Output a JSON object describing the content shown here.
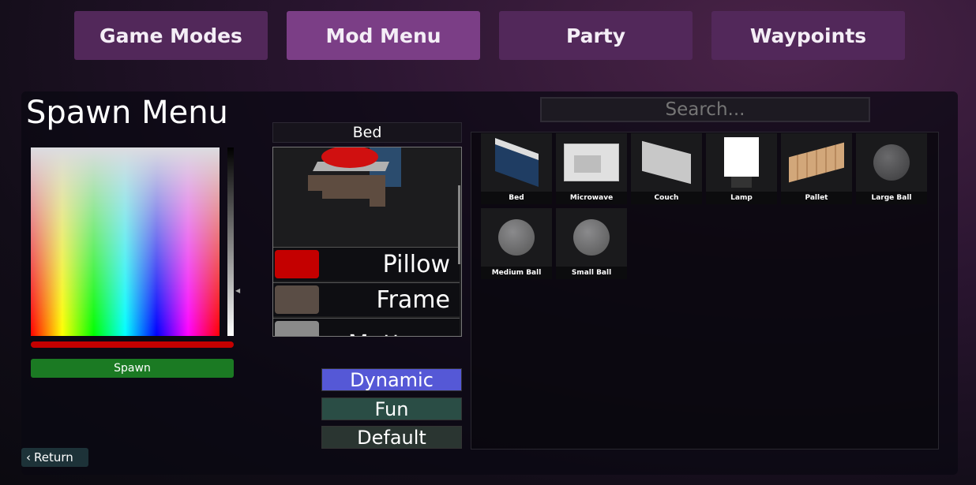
{
  "tabs": [
    {
      "label": "Game Modes",
      "active": false
    },
    {
      "label": "Mod Menu",
      "active": true
    },
    {
      "label": "Party",
      "active": false
    },
    {
      "label": "Waypoints",
      "active": false
    }
  ],
  "spawn_menu": {
    "title": "Spawn Menu",
    "selected_color": "#c40000",
    "spawn_label": "Spawn",
    "return_label": "Return"
  },
  "object": {
    "name": "Bed",
    "parts": [
      {
        "label": "Pillow",
        "color": "#c40000"
      },
      {
        "label": "Frame",
        "color": "#5a4d45"
      },
      {
        "label": "Mattress",
        "color": "#8a8a8a"
      }
    ]
  },
  "modes": [
    {
      "label": "Dynamic",
      "color": "#5558d6"
    },
    {
      "label": "Fun",
      "color": "#2a4d45"
    },
    {
      "label": "Default",
      "color": "#2a3531"
    }
  ],
  "search": {
    "placeholder": "Search..."
  },
  "items": [
    {
      "label": "Bed"
    },
    {
      "label": "Microwave"
    },
    {
      "label": "Couch"
    },
    {
      "label": "Lamp"
    },
    {
      "label": "Pallet"
    },
    {
      "label": "Large Ball"
    },
    {
      "label": "Medium Ball"
    },
    {
      "label": "Small Ball"
    }
  ]
}
